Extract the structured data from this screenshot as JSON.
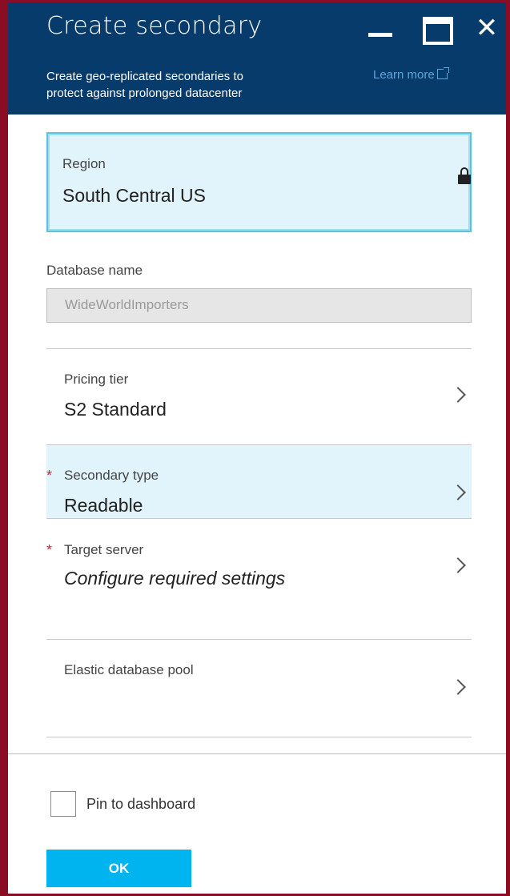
{
  "window": {
    "title": "Create secondary",
    "controls": {
      "minimize": "minimize-icon",
      "maximize": "maximize-icon",
      "close": "✕"
    }
  },
  "header": {
    "subtitle_line1": "Create geo-replicated secondaries to",
    "subtitle_line2": "protect against prolonged datacenter",
    "learn_more": "Learn more",
    "link_icon": "external-link-icon"
  },
  "region": {
    "label": "Region",
    "value": "South Central US",
    "icon": "lock-icon"
  },
  "database": {
    "label": "Database name",
    "value": "WideWorldImporters"
  },
  "rows": [
    {
      "label": "Pricing tier",
      "value": "S2 Standard",
      "required": false
    },
    {
      "label": "Secondary type",
      "value": "Readable",
      "required": true
    },
    {
      "label": "Target server",
      "value": "Configure required settings",
      "required": true
    },
    {
      "label": "Elastic database pool",
      "value": "",
      "required": false
    }
  ],
  "required_marker": "*",
  "footer": {
    "pin_label": "Pin to dashboard",
    "pin_checked": false,
    "ok_label": "OK"
  },
  "colors": {
    "header_bg": "#073b6b",
    "accent": "#00b4f0",
    "frame": "#8b0d24",
    "highlight_bg": "#e1f4fb",
    "required": "#c0283a"
  }
}
